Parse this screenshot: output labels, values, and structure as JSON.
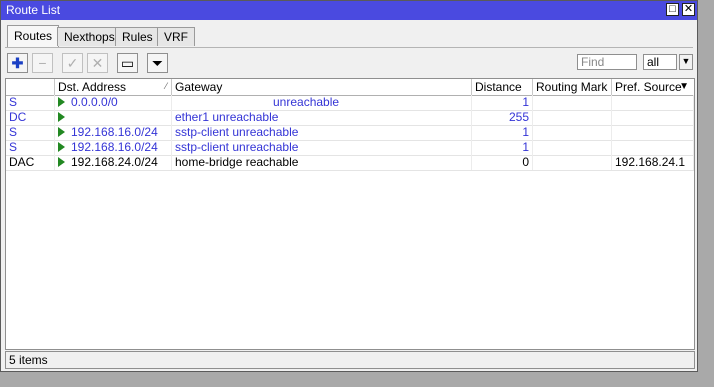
{
  "window": {
    "title": "Route List",
    "restore_glyph": "□",
    "close_glyph": "✕"
  },
  "tabs": [
    {
      "label": "Routes",
      "active": true
    },
    {
      "label": "Nexthops",
      "active": false
    },
    {
      "label": "Rules",
      "active": false
    },
    {
      "label": "VRF",
      "active": false
    }
  ],
  "toolbar": {
    "add_glyph": "✚",
    "remove_glyph": "−",
    "enable_glyph": "✓",
    "disable_glyph": "✕",
    "comment_glyph": "▭",
    "filter_glyph": "⏷",
    "find_placeholder": "Find",
    "filter_select": "all",
    "select_arrow": "▼"
  },
  "table": {
    "columns": [
      "",
      "Dst. Address",
      "Gateway",
      "Distance",
      "Routing Mark",
      "Pref. Source"
    ],
    "header_menu_glyph": "▼",
    "rows": [
      {
        "flags": "S",
        "dst": "0.0.0.0/0",
        "gateway": "unreachable",
        "distance": "1",
        "mark": "",
        "pref": "",
        "color": "blue"
      },
      {
        "flags": "DC",
        "dst": "",
        "gateway": "ether1 unreachable",
        "distance": "255",
        "mark": "",
        "pref": "",
        "color": "blue"
      },
      {
        "flags": "S",
        "dst": "192.168.16.0/24",
        "gateway": "sstp-client unreachable",
        "distance": "1",
        "mark": "",
        "pref": "",
        "color": "blue"
      },
      {
        "flags": "S",
        "dst": "192.168.16.0/24",
        "gateway": "sstp-client unreachable",
        "distance": "1",
        "mark": "",
        "pref": "",
        "color": "blue"
      },
      {
        "flags": "DAC",
        "dst": "192.168.24.0/24",
        "gateway": "home-bridge reachable",
        "distance": "0",
        "mark": "",
        "pref": "192.168.24.1",
        "color": "black"
      }
    ]
  },
  "status": {
    "count": "5 items"
  },
  "colors": {
    "titlebar": "#4a4ae0",
    "unreachable_row": "#3434d6",
    "route_arrow": "#228822"
  }
}
